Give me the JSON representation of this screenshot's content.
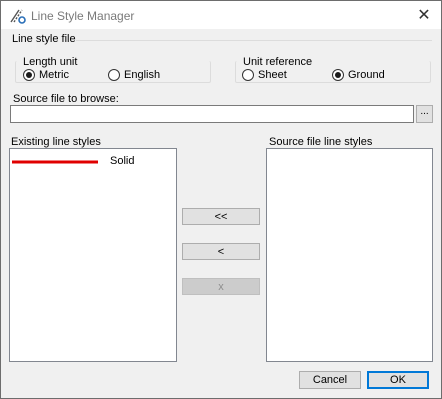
{
  "window": {
    "title": "Line Style Manager",
    "close_glyph": "✕"
  },
  "line_style_file": {
    "group_label": "Line style file",
    "length_unit": {
      "label": "Length unit",
      "options": [
        "Metric",
        "English"
      ],
      "selected": "Metric"
    },
    "unit_reference": {
      "label": "Unit reference",
      "options": [
        "Sheet",
        "Ground"
      ],
      "selected": "Ground"
    }
  },
  "source_file": {
    "label": "Source file to browse:",
    "value": "",
    "browse_label": "..."
  },
  "existing": {
    "label": "Existing line styles",
    "items": [
      {
        "name": "Solid",
        "swatch_color": "#e00000"
      }
    ]
  },
  "source_styles": {
    "label": "Source file line styles",
    "items": []
  },
  "transfer_buttons": {
    "copy_all": "<<",
    "copy_one": "<",
    "delete": "x"
  },
  "footer": {
    "cancel": "Cancel",
    "ok": "OK"
  },
  "colors": {
    "accent": "#0078d7",
    "title_icon": "#2a6fb8"
  }
}
